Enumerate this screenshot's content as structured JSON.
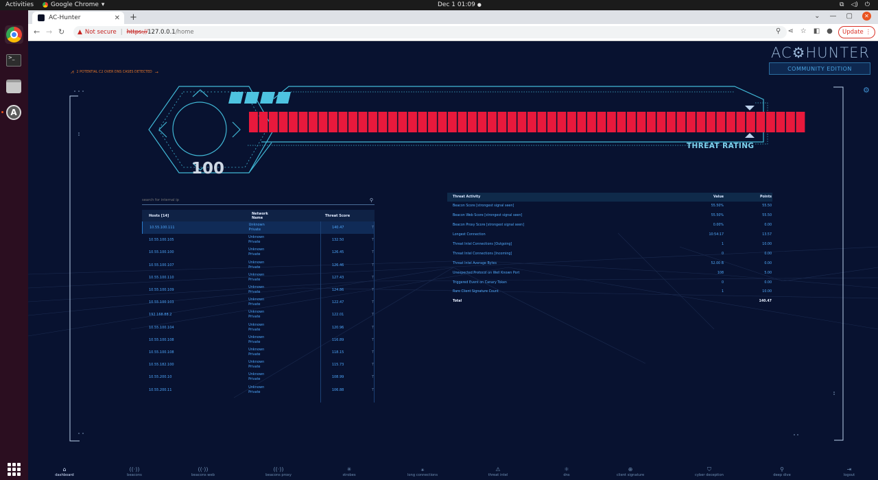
{
  "system": {
    "activities": "Activities",
    "app_name": "Google Chrome",
    "clock": "Dec 1  01:09"
  },
  "browser": {
    "tab_title": "AC-Hunter",
    "security_label": "Not secure",
    "url_protocol": "https://",
    "url_host": "127.0.0.1",
    "url_path": "/home",
    "update_label": "Update"
  },
  "app": {
    "logo": "AC⚙HUNTER",
    "edition": "COMMUNITY EDITION",
    "alert_text": "2 POTENTIAL C2 OVER DNS CASES DETECTED"
  },
  "threat": {
    "score": "100",
    "rating_label": "THREAT RATING",
    "score_fraction": 1.0
  },
  "search": {
    "placeholder": "search for internal ip"
  },
  "hosts": {
    "columns": [
      "Hosts [14]",
      "Network\nName",
      "Threat Score"
    ],
    "rows": [
      {
        "host": "10.55.100.111",
        "net": "Unknown Private",
        "score": "140.47"
      },
      {
        "host": "10.55.100.105",
        "net": "Unknown Private",
        "score": "132.50"
      },
      {
        "host": "10.55.100.100",
        "net": "Unknown Private",
        "score": "126.45"
      },
      {
        "host": "10.55.100.107",
        "net": "Unknown Private",
        "score": "126.46"
      },
      {
        "host": "10.55.100.110",
        "net": "Unknown Private",
        "score": "127.43"
      },
      {
        "host": "10.55.100.109",
        "net": "Unknown Private",
        "score": "124.86"
      },
      {
        "host": "10.55.100.103",
        "net": "Unknown Private",
        "score": "122.47"
      },
      {
        "host": "192.168.88.2",
        "net": "Unknown Private",
        "score": "122.01"
      },
      {
        "host": "10.55.100.104",
        "net": "Unknown Private",
        "score": "120.96"
      },
      {
        "host": "10.55.100.108",
        "net": "Unknown Private",
        "score": "116.89"
      },
      {
        "host": "10.55.100.108",
        "net": "Unknown Private",
        "score": "118.15"
      },
      {
        "host": "10.55.182.100",
        "net": "Unknown Private",
        "score": "115.73"
      },
      {
        "host": "10.55.200.10",
        "net": "Unknown Private",
        "score": "108.99"
      },
      {
        "host": "10.55.200.11",
        "net": "Unknown Private",
        "score": "106.88"
      }
    ]
  },
  "activity": {
    "columns": [
      "Threat Activity",
      "Value",
      "Points"
    ],
    "rows": [
      {
        "name": "Beacon Score [strongest signal seen]",
        "value": "55.50%",
        "points": "55.50"
      },
      {
        "name": "Beacon Web Score [strongest signal seen]",
        "value": "55.50%",
        "points": "55.50"
      },
      {
        "name": "Beacon Proxy Score [strongest signal seen]",
        "value": "0.00%",
        "points": "0.00"
      },
      {
        "name": "Longest Connection",
        "value": "10:54:17",
        "points": "13.57"
      },
      {
        "name": "Threat Intel Connections [Outgoing]",
        "value": "1",
        "points": "10.00"
      },
      {
        "name": "Threat Intel Connections [Incoming]",
        "value": "0",
        "points": "0.00"
      },
      {
        "name": "Threat Intel Average Bytes",
        "value": "52.00 B",
        "points": "0.00"
      },
      {
        "name": "Unexpected Protocol on Well Known Port",
        "value": "108",
        "points": "5.00"
      },
      {
        "name": "Triggered Event on Canary Token",
        "value": "0",
        "points": "0.00"
      },
      {
        "name": "Rare Client Signature Count",
        "value": "1",
        "points": "10.00"
      }
    ],
    "total_label": "Total",
    "total_points": "140.47"
  },
  "nav": [
    {
      "label": "dashboard",
      "icon": "home-icon",
      "glyph": "⌂"
    },
    {
      "label": "beacons",
      "icon": "beacon-icon",
      "glyph": "((·))"
    },
    {
      "label": "beacons web",
      "icon": "beacon-web-icon",
      "glyph": "((·))"
    },
    {
      "label": "beacons proxy",
      "icon": "beacon-proxy-icon",
      "glyph": "((·))"
    },
    {
      "label": "strobes",
      "icon": "strobe-icon",
      "glyph": "✳"
    },
    {
      "label": "long connections",
      "icon": "long-connection-icon",
      "glyph": "⚹"
    },
    {
      "label": "threat intel",
      "icon": "warning-icon",
      "glyph": "⚠"
    },
    {
      "label": "dns",
      "icon": "dns-icon",
      "glyph": "⚛"
    },
    {
      "label": "client signature",
      "icon": "signature-icon",
      "glyph": "⊕"
    },
    {
      "label": "cyber deception",
      "icon": "shield-icon",
      "glyph": "⛉"
    },
    {
      "label": "deep dive",
      "icon": "deep-dive-icon",
      "glyph": "⚲"
    },
    {
      "label": "logout",
      "icon": "logout-icon",
      "glyph": "⇥"
    }
  ],
  "colors": {
    "threat_bar": "#e8193c",
    "accent_cyan": "#41b8d6",
    "link_blue": "#4fa9ff"
  }
}
